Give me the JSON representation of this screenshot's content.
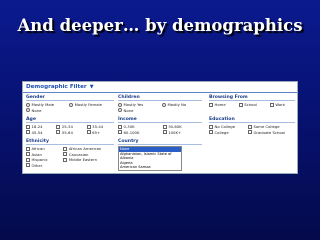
{
  "slide": {
    "title": "And deeper… by demographics"
  },
  "filter": {
    "header": "Demographic Filter",
    "gender": {
      "title": "Gender",
      "options": [
        "Mostly Male",
        "Mostly Female",
        "None"
      ]
    },
    "children": {
      "title": "Children",
      "options": [
        "Mostly Yes",
        "Mostly No",
        "None"
      ]
    },
    "browsing": {
      "title": "Browsing From",
      "options": [
        "Home",
        "School",
        "Work"
      ]
    },
    "age": {
      "title": "Age",
      "options": [
        "18-24",
        "25-34",
        "35-44",
        "45-54",
        "55-64",
        "65+"
      ]
    },
    "income": {
      "title": "Income",
      "options": [
        "0-30K",
        "30-60K",
        "60-100K",
        "100K+"
      ]
    },
    "education": {
      "title": "Education",
      "options": [
        "No College",
        "Some College",
        "College",
        "Graduate School"
      ]
    },
    "ethnicity": {
      "title": "Ethnicity",
      "options": [
        "African",
        "African American",
        "Asian",
        "Caucasian",
        "Hispanic",
        "Middle Eastern",
        "Other"
      ]
    },
    "country": {
      "title": "Country",
      "selected": "None",
      "options": [
        "None",
        "Afghanistan, Islamic State of",
        "Albania",
        "Algeria",
        "American Samoa"
      ]
    }
  }
}
